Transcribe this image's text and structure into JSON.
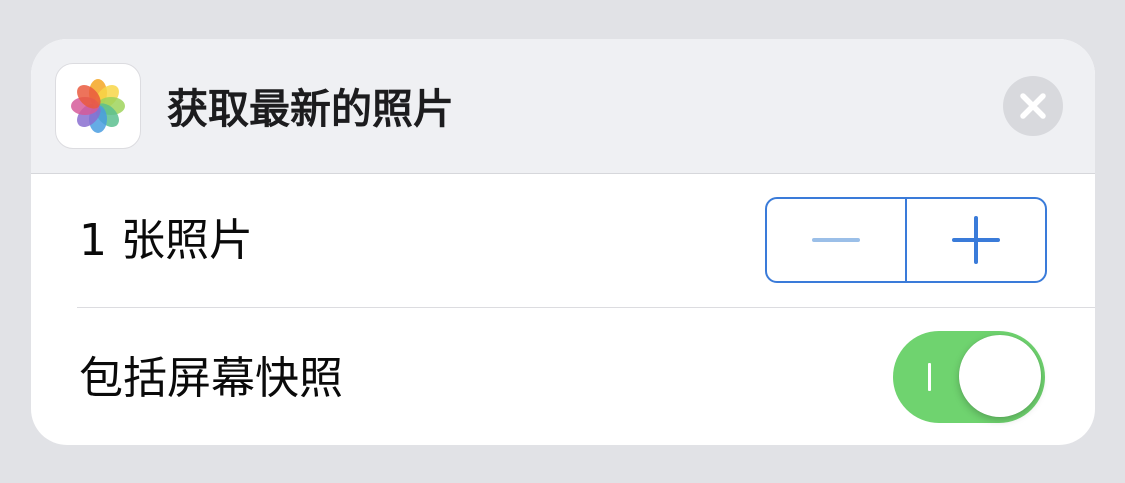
{
  "action": {
    "title": "获取最新的照片",
    "icon": "photos-app-icon"
  },
  "close_button": {
    "icon": "close-icon"
  },
  "count_row": {
    "label": "1 张照片",
    "value": 1,
    "decrement_icon": "minus-icon",
    "increment_icon": "plus-icon"
  },
  "screenshots_row": {
    "label": "包括屏幕快照",
    "toggle_on": true
  },
  "colors": {
    "accent_blue": "#3a7bd9",
    "toggle_green": "#6fd36f",
    "header_bg": "#eff0f3",
    "page_bg": "#e1e2e6"
  }
}
